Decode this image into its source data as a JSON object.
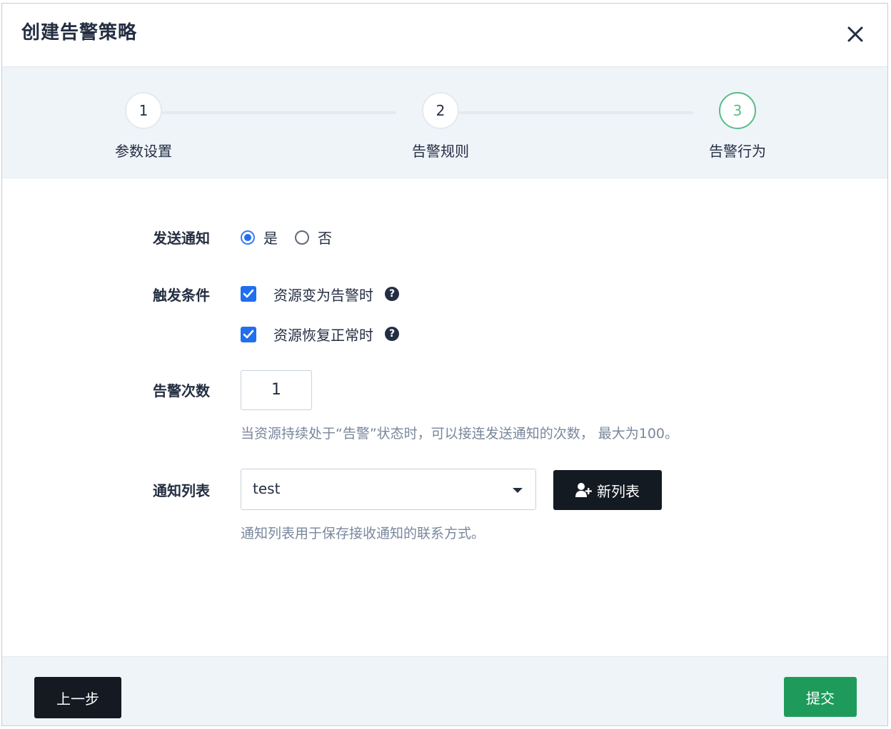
{
  "dialog": {
    "title": "创建告警策略"
  },
  "steps": [
    {
      "number": "1",
      "label": "参数设置"
    },
    {
      "number": "2",
      "label": "告警规则"
    },
    {
      "number": "3",
      "label": "告警行为"
    }
  ],
  "form": {
    "send_notification": {
      "label": "发送通知",
      "options": [
        "是",
        "否"
      ],
      "selected": "是"
    },
    "trigger": {
      "label": "触发条件",
      "options": [
        {
          "label": "资源变为告警时",
          "checked": true
        },
        {
          "label": "资源恢复正常时",
          "checked": true
        }
      ]
    },
    "alert_count": {
      "label": "告警次数",
      "value": "1",
      "hint": "当资源持续处于“告警”状态时，可以接连发送通知的次数， 最大为100。"
    },
    "notify_list": {
      "label": "通知列表",
      "value": "test",
      "new_button": "新列表",
      "hint": "通知列表用于保存接收通知的联系方式。"
    }
  },
  "footer": {
    "prev_label": "上一步",
    "submit_label": "提交"
  },
  "colors": {
    "primary_blue": "#1f6ff0",
    "success_green": "#1e9b5a",
    "dark": "#141a22"
  }
}
